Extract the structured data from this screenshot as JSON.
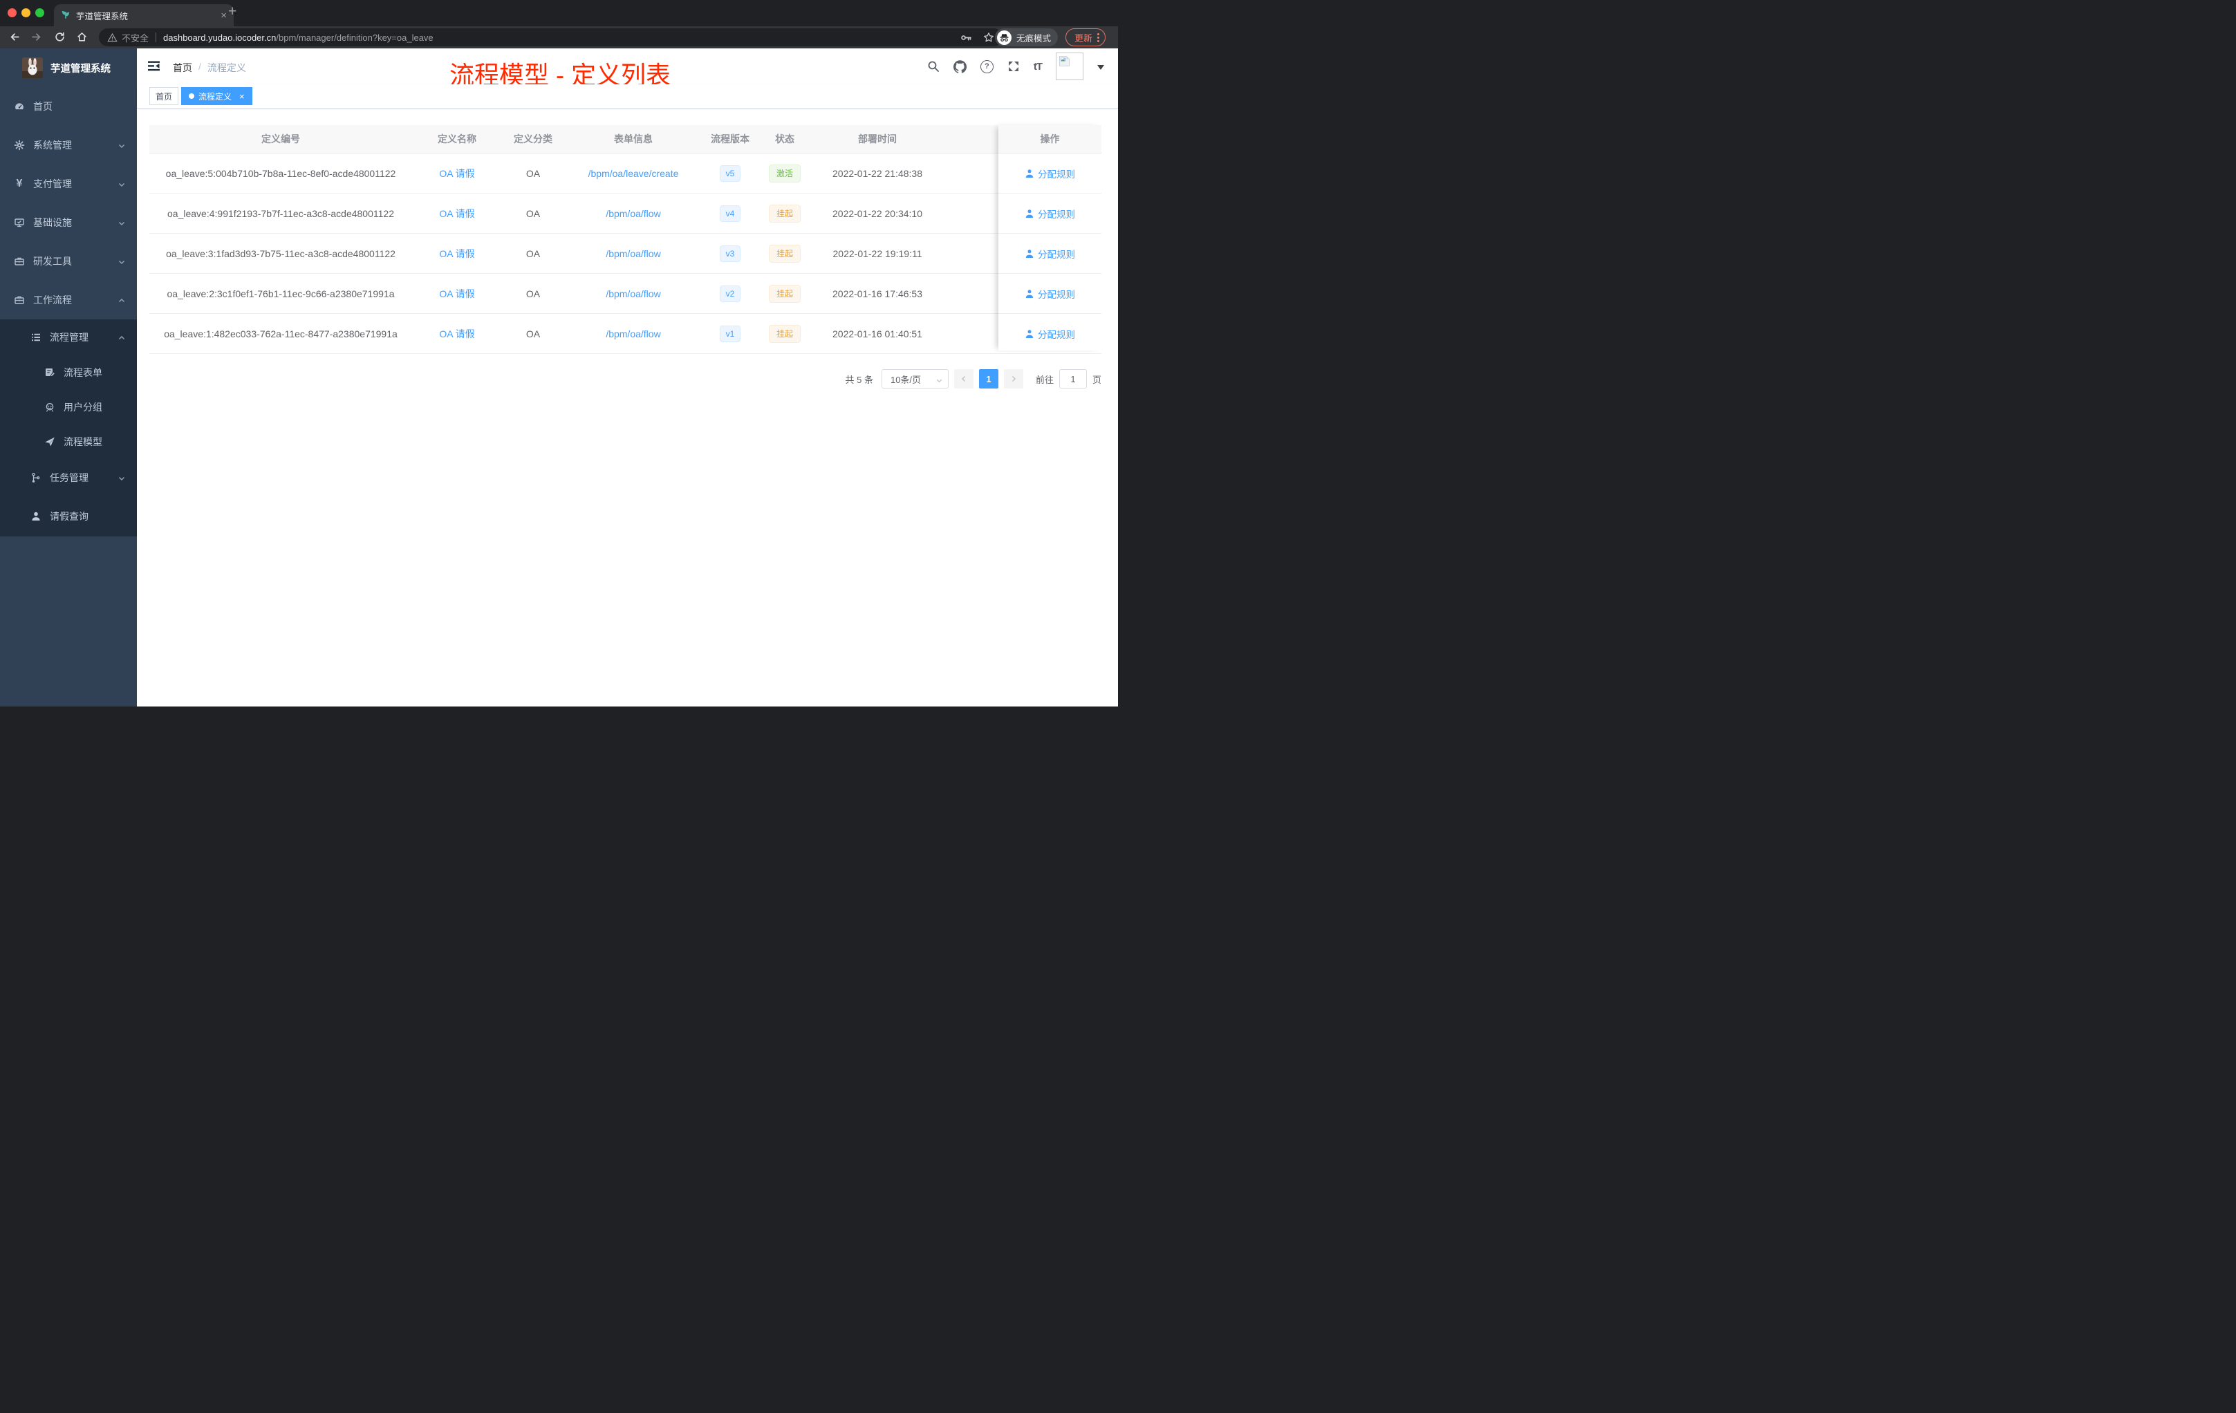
{
  "browser": {
    "tab_title": "芋道管理系统",
    "close_icon": "×",
    "new_tab_icon": "+",
    "insecure_label": "不安全",
    "url_domain": "dashboard.yudao.iocoder.cn",
    "url_path": "/bpm/manager/definition?key=oa_leave",
    "incognito_label": "无痕模式",
    "update_label": "更新"
  },
  "header": {
    "breadcrumb_home": "首页",
    "breadcrumb_sep": "/",
    "breadcrumb_current": "流程定义",
    "annotation": "流程模型 - 定义列表",
    "font_size_icon": "tT",
    "question_mark": "?"
  },
  "sidebar": {
    "title": "芋道管理系统",
    "items": [
      {
        "label": "首页"
      },
      {
        "label": "系统管理"
      },
      {
        "label": "支付管理"
      },
      {
        "label": "基础设施"
      },
      {
        "label": "研发工具"
      },
      {
        "label": "工作流程",
        "children": [
          {
            "label": "流程管理",
            "children": [
              {
                "label": "流程表单"
              },
              {
                "label": "用户分组"
              },
              {
                "label": "流程模型"
              }
            ]
          },
          {
            "label": "任务管理"
          },
          {
            "label": "请假查询"
          }
        ]
      }
    ]
  },
  "tags": [
    {
      "label": "首页"
    },
    {
      "label": "流程定义",
      "close_icon": "×"
    }
  ],
  "table": {
    "columns": [
      "定义编号",
      "定义名称",
      "定义分类",
      "表单信息",
      "流程版本",
      "状态",
      "部署时间",
      "操作"
    ],
    "rows": [
      {
        "id": "oa_leave:5:004b710b-7b8a-11ec-8ef0-acde48001122",
        "name": "OA 请假",
        "category": "OA",
        "form": "/bpm/oa/leave/create",
        "version": "v5",
        "status": "激活",
        "status_type": "success",
        "time": "2022-01-22 21:48:38",
        "action": "分配规则"
      },
      {
        "id": "oa_leave:4:991f2193-7b7f-11ec-a3c8-acde48001122",
        "name": "OA 请假",
        "category": "OA",
        "form": "/bpm/oa/flow",
        "version": "v4",
        "status": "挂起",
        "status_type": "warning",
        "time": "2022-01-22 20:34:10",
        "action": "分配规则"
      },
      {
        "id": "oa_leave:3:1fad3d93-7b75-11ec-a3c8-acde48001122",
        "name": "OA 请假",
        "category": "OA",
        "form": "/bpm/oa/flow",
        "version": "v3",
        "status": "挂起",
        "status_type": "warning",
        "time": "2022-01-22 19:19:11",
        "action": "分配规则"
      },
      {
        "id": "oa_leave:2:3c1f0ef1-76b1-11ec-9c66-a2380e71991a",
        "name": "OA 请假",
        "category": "OA",
        "form": "/bpm/oa/flow",
        "version": "v2",
        "status": "挂起",
        "status_type": "warning",
        "time": "2022-01-16 17:46:53",
        "action": "分配规则"
      },
      {
        "id": "oa_leave:1:482ec033-762a-11ec-8477-a2380e71991a",
        "name": "OA 请假",
        "category": "OA",
        "form": "/bpm/oa/flow",
        "version": "v1",
        "status": "挂起",
        "status_type": "warning",
        "time": "2022-01-16 01:40:51",
        "action": "分配规则"
      }
    ]
  },
  "pagination": {
    "total_label": "共 5 条",
    "page_size_label": "10条/页",
    "current_page": "1",
    "goto_label": "前往",
    "goto_value": "1",
    "page_unit_label": "页"
  },
  "colors": {
    "accent": "#409eff",
    "annotation_red": "#ff2a00",
    "status_active": "#67c23a",
    "status_suspended": "#e6a23c",
    "sidebar_bg": "#304156",
    "sidebar_submenu_bg": "#1f2d3d"
  }
}
